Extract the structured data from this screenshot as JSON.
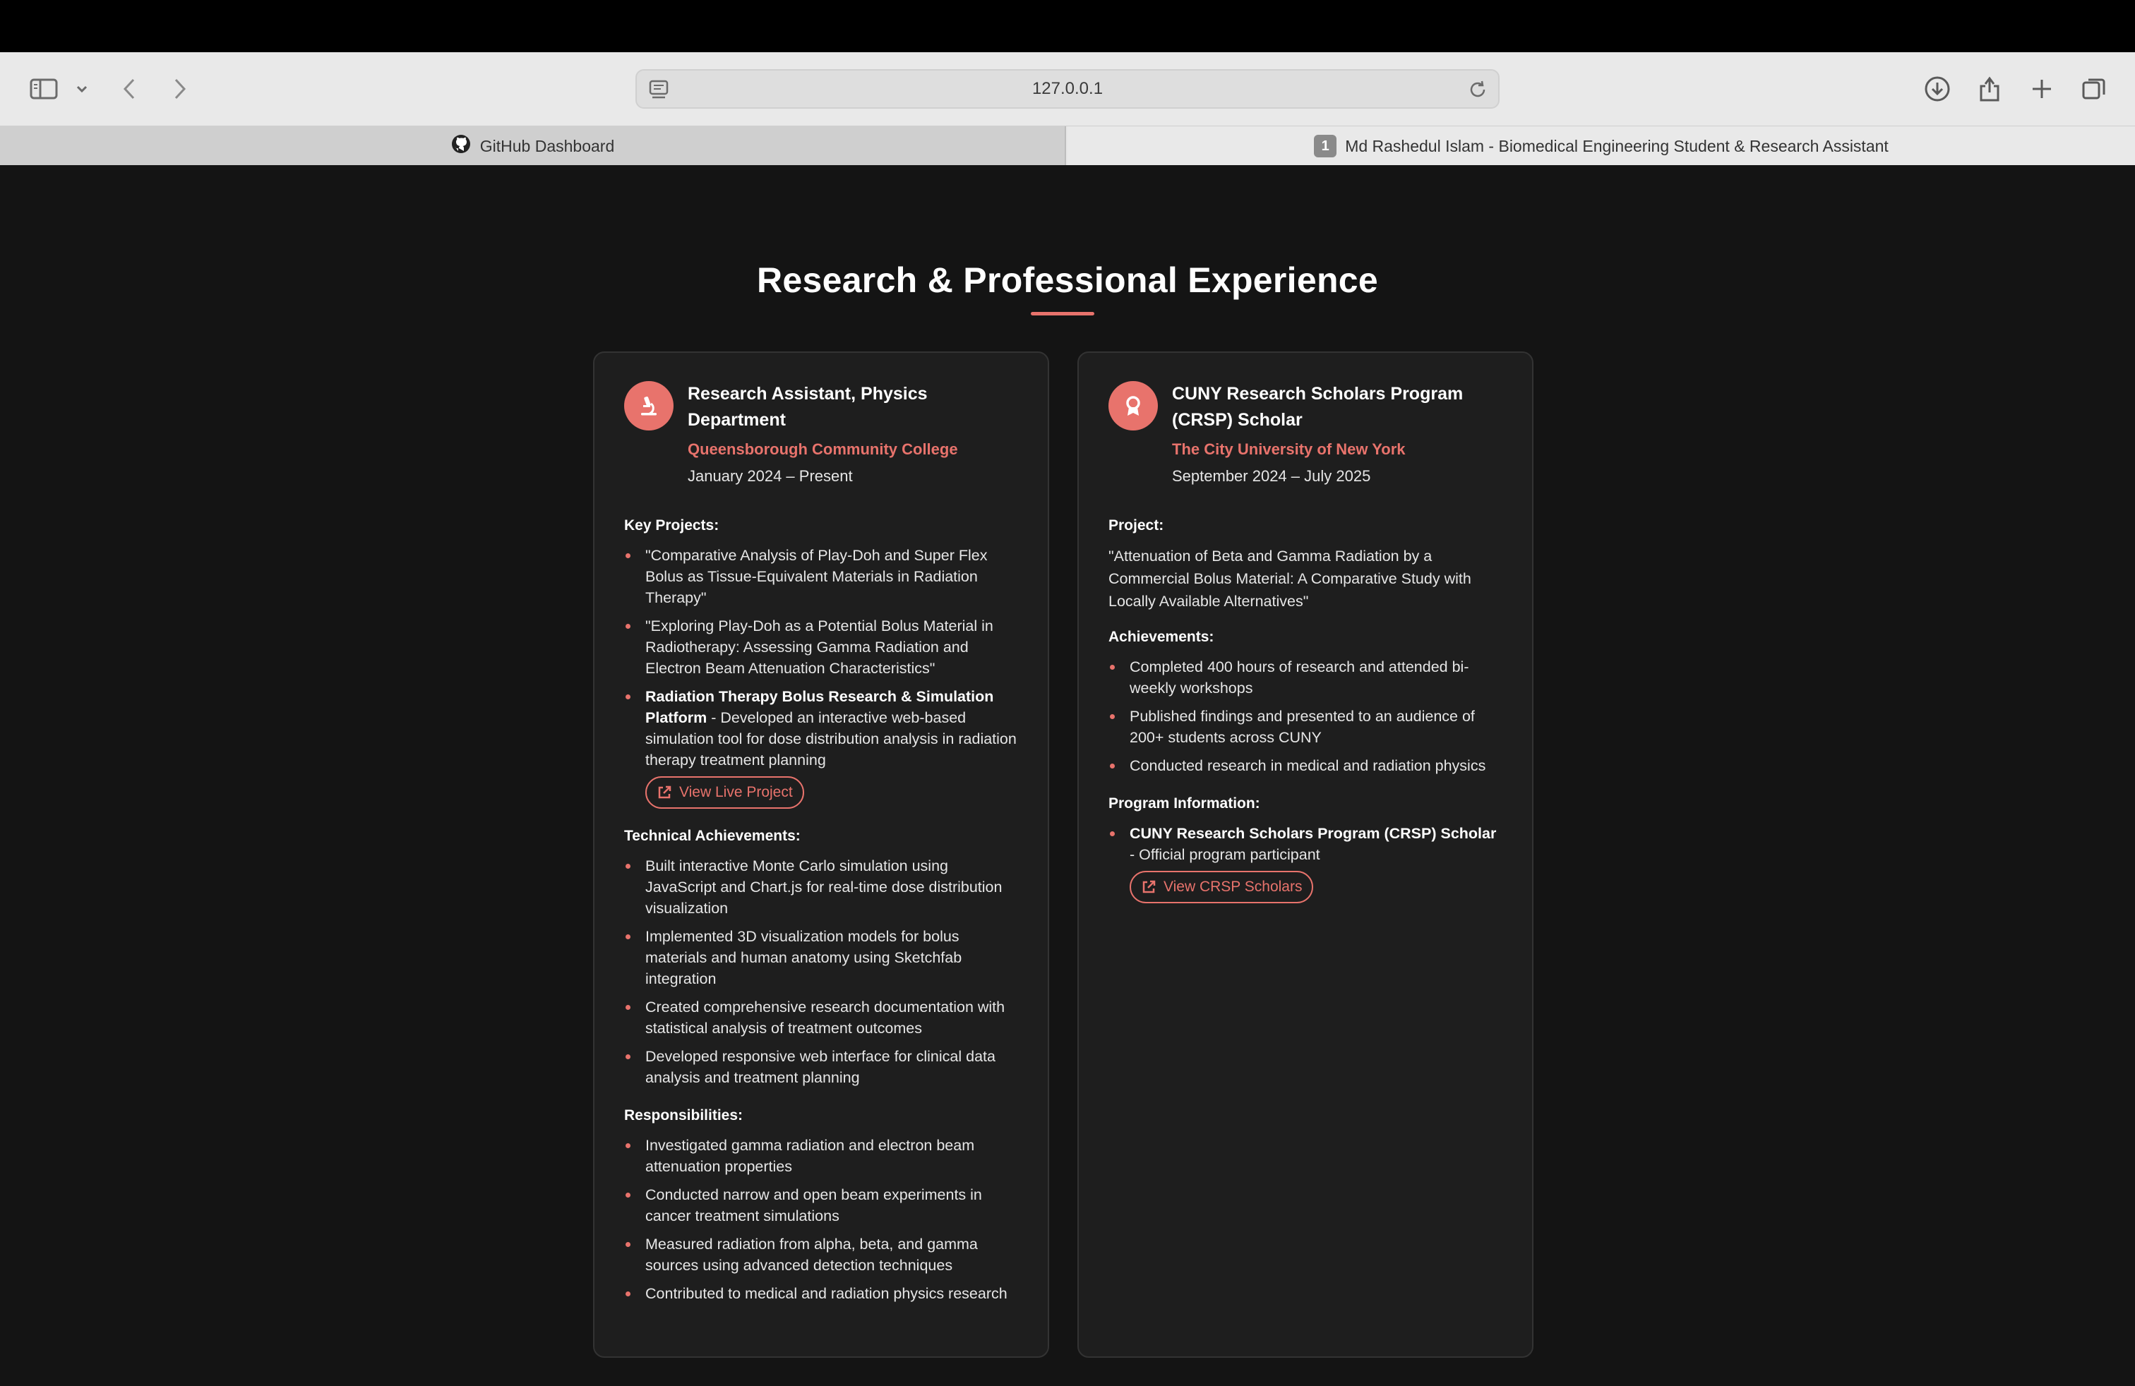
{
  "browser": {
    "url": "127.0.0.1",
    "tabs": [
      {
        "label": "GitHub Dashboard",
        "active": false
      },
      {
        "label": "Md Rashedul Islam - Biomedical Engineering Student & Research Assistant",
        "active": true,
        "badge": "1"
      }
    ]
  },
  "section": {
    "title": "Research & Professional Experience",
    "accent_color": "#e8736c"
  },
  "cards": [
    {
      "icon": "microscope-icon",
      "role": "Research Assistant, Physics Department",
      "org": "Queensborough Community College",
      "dates": "January 2024 – Present",
      "key_projects_heading": "Key Projects:",
      "key_projects": [
        "\"Comparative Analysis of Play-Doh and Super Flex Bolus as Tissue-Equivalent Materials in Radiation Therapy\"",
        "\"Exploring Play-Doh as a Potential Bolus Material in Radiotherapy: Assessing Gamma Radiation and Electron Beam Attenuation Characteristics\""
      ],
      "platform_title": "Radiation Therapy Bolus Research & Simulation Platform",
      "platform_desc": " - Developed an interactive web-based simulation tool for dose distribution analysis in radiation therapy treatment planning",
      "live_project_label": "View Live Project",
      "technical_heading": "Technical Achievements:",
      "technical": [
        "Built interactive Monte Carlo simulation using JavaScript and Chart.js for real-time dose distribution visualization",
        "Implemented 3D visualization models for bolus materials and human anatomy using Sketchfab integration",
        "Created comprehensive research documentation with statistical analysis of treatment outcomes",
        "Developed responsive web interface for clinical data analysis and treatment planning"
      ],
      "responsibilities_heading": "Responsibilities:",
      "responsibilities": [
        "Investigated gamma radiation and electron beam attenuation properties",
        "Conducted narrow and open beam experiments in cancer treatment simulations",
        "Measured radiation from alpha, beta, and gamma sources using advanced detection techniques",
        "Contributed to medical and radiation physics research"
      ]
    },
    {
      "icon": "award-icon",
      "role": "CUNY Research Scholars Program (CRSP) Scholar",
      "org": "The City University of New York",
      "dates": "September 2024 – July 2025",
      "project_heading": "Project:",
      "project_text": "\"Attenuation of Beta and Gamma Radiation by a Commercial Bolus Material: A Comparative Study with Locally Available Alternatives\"",
      "achievements_heading": "Achievements:",
      "achievements": [
        "Completed 400 hours of research and attended bi-weekly workshops",
        "Published findings and presented to an audience of 200+ students across CUNY",
        "Conducted research in medical and radiation physics"
      ],
      "program_heading": "Program Information:",
      "program_title": "CUNY Research Scholars Program (CRSP) Scholar",
      "program_desc": " - Official program participant",
      "crsp_link_label": "View CRSP Scholars"
    }
  ]
}
